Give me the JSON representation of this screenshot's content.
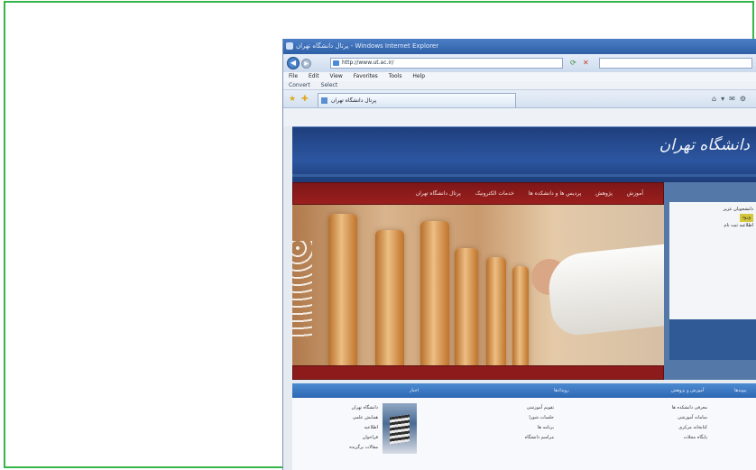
{
  "browser": {
    "title": "پرتال دانشگاه تهران - Windows Internet Explorer",
    "url": "http://www.ut.ac.ir/",
    "menu": [
      "File",
      "Edit",
      "View",
      "Favorites",
      "Tools",
      "Help"
    ],
    "links": [
      "Convert",
      "Select"
    ],
    "tab_title": "پرتال دانشگاه تهران"
  },
  "site": {
    "logo": "دانشگاه تهران",
    "nav": [
      "آموزش",
      "پژوهش",
      "پردیس ها و دانشکده ها",
      "خدمات الکترونیک",
      "پرتال دانشگاه تهران"
    ],
    "panel": {
      "line1": "دانشجویان عزیز",
      "badge": "ورود",
      "line2": "اطلاعیه ثبت نام"
    },
    "sections": [
      "اخبار",
      "رویدادها",
      "آموزش و پژوهش",
      "پیوندها"
    ],
    "col_news": [
      "دانشگاه تهران",
      "همایش علمی",
      "اطلاعیه",
      "فراخوان",
      "مقالات برگزیده"
    ],
    "col_events": [
      "تقویم آموزشی",
      "جلسات شورا",
      "برنامه ها",
      "مراسم دانشگاه"
    ],
    "col_research": [
      "معرفی دانشکده ها",
      "سامانه آموزشی",
      "کتابخانه مرکزی",
      "پایگاه مجلات"
    ]
  }
}
